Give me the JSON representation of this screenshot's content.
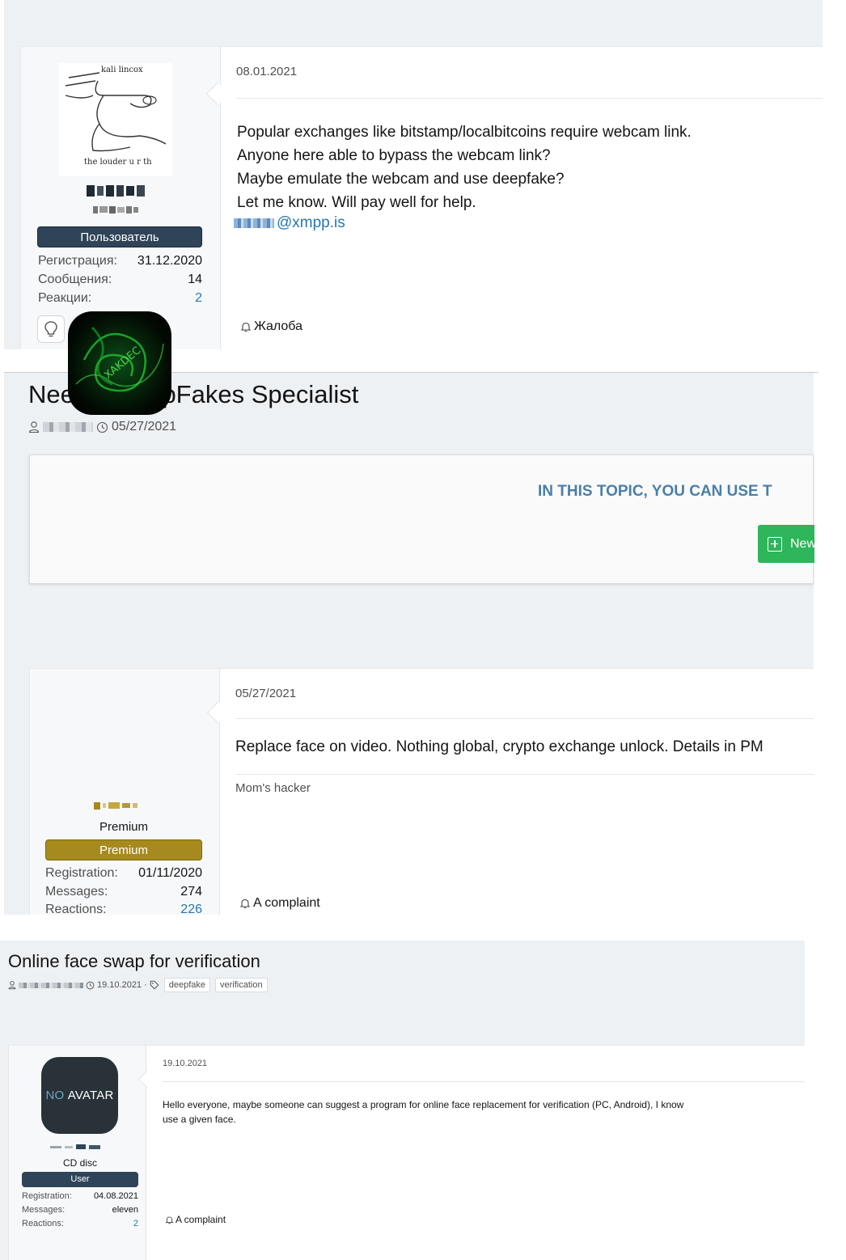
{
  "post1": {
    "date": "08.01.2021",
    "avatar_text_top": "kali lincox",
    "avatar_text_bottom": "the louder u r th",
    "username": "XMSS",
    "user_title": "Ozkpura",
    "role": "Пользователь",
    "stats": [
      {
        "label": "Регистрация:",
        "value": "31.12.2020"
      },
      {
        "label": "Сообщения:",
        "value": "14"
      },
      {
        "label": "Реакции:",
        "value": "2"
      }
    ],
    "body_lines": [
      "Popular exchanges like bitstamp/localbitcoins require webcam link.",
      "Anyone here able to bypass the webcam link?",
      "Maybe emulate the webcam and use deepfake?",
      "Let me know. Will pay well for help."
    ],
    "contact_masked": "xmss",
    "contact_domain": "@xmpp.is",
    "report_label": "Жалоба",
    "colors": {
      "role_bg": "#2f4458",
      "link": "#2577b1"
    }
  },
  "topic2": {
    "title": "Need a DeepFakes Specialist",
    "author_masked": "Tarfer",
    "date": "05/27/2021",
    "notice": "IN THIS TOPIC, YOU CAN USE T",
    "new_button": "New"
  },
  "post2": {
    "date": "05/27/2021",
    "avatar_text": "XAKDEC",
    "username": "hacker",
    "user_title": "Premium",
    "role": "Premium",
    "stats": [
      {
        "label": "Registration:",
        "value": "01/11/2020"
      },
      {
        "label": "Messages:",
        "value": "274"
      },
      {
        "label": "Reactions:",
        "value": "226"
      }
    ],
    "body": "Replace face on video. Nothing global, crypto exchange unlock. Details in PM",
    "signature": "Mom's hacker",
    "report_label": "A complaint",
    "colors": {
      "role_bg": "#a68a1d",
      "button": "#2fb55a",
      "notice": "#4a7fa8"
    }
  },
  "topic3": {
    "title": "Online face swap for verification",
    "author_masked": "cyber enthu",
    "date": "19.10.2021",
    "separator": "·",
    "tags": [
      "deepfake",
      "verification"
    ]
  },
  "post3": {
    "date": "19.10.2021",
    "avatar_no": "NO",
    "avatar_word": "AVATAR",
    "username": "cd disc",
    "user_title": "CD disc",
    "role": "User",
    "stats": [
      {
        "label": "Registration:",
        "value": "04.08.2021"
      },
      {
        "label": "Messages:",
        "value": "eleven"
      },
      {
        "label": "Reactions:",
        "value": "2"
      }
    ],
    "body_line1": "Hello everyone, maybe someone can suggest a program for online face replacement for verification (PC, Android), I know",
    "body_line2": "use a given face.",
    "report_label": "A complaint",
    "colors": {
      "role_bg": "#2f4458"
    }
  }
}
